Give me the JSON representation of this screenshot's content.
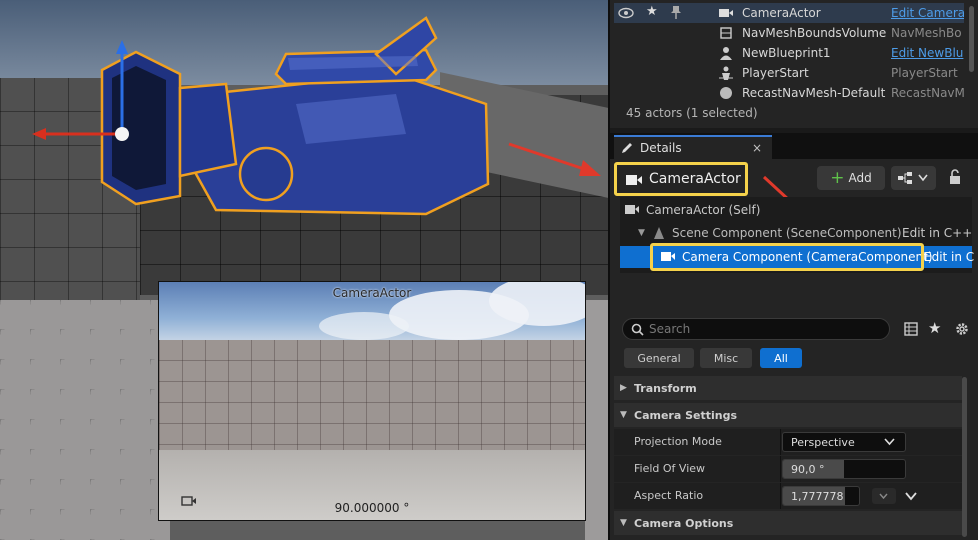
{
  "colors": {
    "accent": "#0f6fd0",
    "highlight": "#f5d24b",
    "link": "#4d9ce8",
    "annotation": "#e0392b",
    "mesh": "#2a3f8f"
  },
  "viewport": {
    "pip_title": "CameraActor",
    "pip_fov": "90.000000 °"
  },
  "outliner": {
    "rows": [
      {
        "name": "CameraActor",
        "type": "Edit Camera",
        "icon": "camera-icon",
        "type_is_link": true,
        "selected": true
      },
      {
        "name": "NavMeshBoundsVolume",
        "type": "NavMeshBo",
        "icon": "cube-icon",
        "type_is_link": false
      },
      {
        "name": "NewBlueprint1",
        "type": "Edit NewBlu",
        "icon": "person-icon",
        "type_is_link": true
      },
      {
        "name": "PlayerStart",
        "type": "PlayerStart",
        "icon": "player-start-icon",
        "type_is_link": false
      },
      {
        "name": "RecastNavMesh-Default",
        "type": "RecastNavM",
        "icon": "sphere-icon",
        "type_is_link": false
      }
    ],
    "actor_count": "45 actors (1 selected)"
  },
  "details": {
    "tab_label": "Details",
    "close_label": "×",
    "actor_name": "CameraActor",
    "add_label": "Add",
    "tree": {
      "self": "CameraActor (Self)",
      "scene": "Scene Component (SceneComponent)",
      "scene_edit": "Edit in C++",
      "camera": "Camera Component (CameraComponent)",
      "camera_edit": "Edit in C"
    },
    "search_placeholder": "Search",
    "filters": [
      "General",
      "Misc",
      "All"
    ],
    "categories": {
      "transform": "Transform",
      "camera_settings": "Camera Settings",
      "camera_options": "Camera Options"
    },
    "props": {
      "projection_label": "Projection Mode",
      "projection_value": "Perspective",
      "fov_label": "Field Of View",
      "fov_value": "90,0 °",
      "fov_level": 0.5,
      "aspect_label": "Aspect Ratio",
      "aspect_value": "1,777778",
      "aspect_level": 0.82
    }
  }
}
